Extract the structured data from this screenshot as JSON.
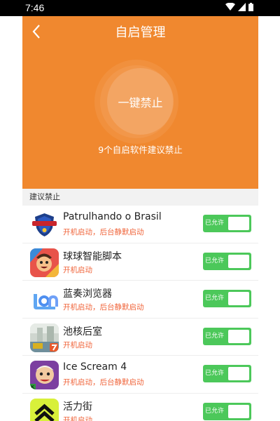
{
  "status": {
    "time": "7:46"
  },
  "header": {
    "title": "自启管理",
    "one_key_label": "一键禁止",
    "suggest_text": "9个自启软件建议禁止",
    "bg_color": "#f0882f"
  },
  "section": {
    "label": "建议禁止"
  },
  "apps": [
    {
      "name": "Patrulhando o Brasil",
      "sub": "开机启动，后台静默启动",
      "toggle_label": "已允许",
      "allowed": true,
      "icon": "police-badge-icon"
    },
    {
      "name": "球球智能脚本",
      "sub": "开机启动",
      "toggle_label": "已允许",
      "allowed": true,
      "icon": "game-character-icon"
    },
    {
      "name": "蓝奏浏览器",
      "sub": "开机启动，后台静默启动",
      "toggle_label": "已允许",
      "allowed": true,
      "icon": "lan-browser-icon"
    },
    {
      "name": "池核后室",
      "sub": "开机启动",
      "toggle_label": "已允许",
      "allowed": true,
      "icon": "pool-room-icon"
    },
    {
      "name": "Ice Scream 4",
      "sub": "开机启动，后台静默启动",
      "toggle_label": "已允许",
      "allowed": true,
      "icon": "ice-scream-icon"
    },
    {
      "name": "活力街",
      "sub": "开机启动",
      "toggle_label": "已允许",
      "allowed": true,
      "icon": "chevron-up-app-icon"
    }
  ],
  "colors": {
    "toggle_on": "#4cc85a",
    "sub_text": "#f0653b"
  }
}
